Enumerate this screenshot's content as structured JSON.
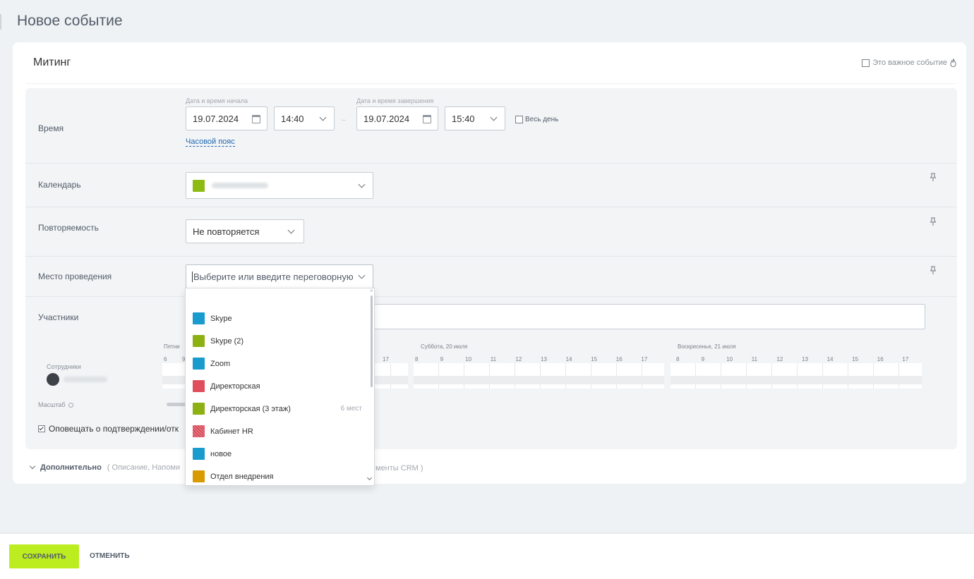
{
  "page": {
    "title": "Новое событие"
  },
  "event": {
    "name": "Митинг",
    "important_label": "Это важное событие"
  },
  "time": {
    "label": "Время",
    "start_label": "Дата и время начала",
    "end_label": "Дата и время завершения",
    "start_date": "19.07.2024",
    "start_time": "14:40",
    "end_date": "19.07.2024",
    "end_time": "15:40",
    "dash": "–",
    "all_day": "Весь день",
    "timezone_link": "Часовой пояс"
  },
  "calendar": {
    "label": "Календарь",
    "color": "#8dbb12"
  },
  "repeat": {
    "label": "Повторяемость",
    "value": "Не повторяется"
  },
  "location": {
    "label": "Место проведения",
    "placeholder": "Выберите или введите переговорную"
  },
  "participants": {
    "label": "Участники",
    "employees_label": "Сотрудники",
    "scale_label": "Масштаб",
    "days": [
      "Пятни",
      "Суббота, 20 июля",
      "Воскресенье, 21 июля"
    ],
    "hours_fri_left": [
      "6",
      "9"
    ],
    "hours_fri_right": [
      "17"
    ],
    "hours_sat": [
      "8",
      "9",
      "10",
      "11",
      "12",
      "13",
      "14",
      "15",
      "16",
      "17"
    ],
    "hours_sun": [
      "8",
      "9",
      "10",
      "11",
      "12",
      "13",
      "14",
      "15",
      "16",
      "17"
    ]
  },
  "notify": {
    "label": "Оповещать о подтверждении/отк"
  },
  "more": {
    "label": "Дополнительно",
    "details_left": "( Описание,  Напоми",
    "details_right": "менты CRM )"
  },
  "rooms": [
    {
      "name": "Skype",
      "color": "#1a9bce",
      "extra": ""
    },
    {
      "name": "Skype (2)",
      "color": "#8db012",
      "extra": ""
    },
    {
      "name": "Zoom",
      "color": "#1a9bce",
      "extra": ""
    },
    {
      "name": "Директорская",
      "color": "#e04e5e",
      "extra": ""
    },
    {
      "name": "Директорская (3 этаж)",
      "color": "#8db012",
      "extra": "6 мест"
    },
    {
      "name": "Кабинет HR",
      "color": "#d94a5a",
      "extra": ""
    },
    {
      "name": "новое",
      "color": "#1a9bce",
      "extra": ""
    },
    {
      "name": "Отдел внедрения",
      "color": "#d99a00",
      "extra": ""
    }
  ],
  "buttons": {
    "save": "СОХРАНИТЬ",
    "cancel": "ОТМЕНИТЬ"
  },
  "icons": [
    "calendar-icon",
    "chevron-down-icon",
    "pin-icon",
    "flame-icon",
    "checkbox-icon",
    "settings-icon",
    "avatar"
  ]
}
